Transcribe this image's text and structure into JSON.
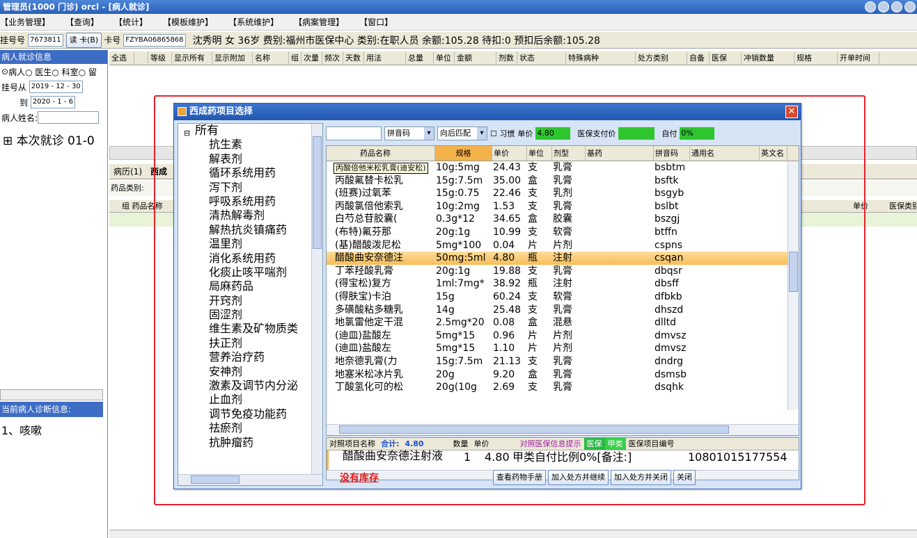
{
  "window": {
    "title": "管理员(1000 门诊)  orcl - [病人就诊]"
  },
  "menu": [
    "【业务管理】",
    "【查询】",
    "【统计】",
    "【模板维护】",
    "【系统维护】",
    "【病案管理】",
    "【窗口】"
  ],
  "patient": {
    "reg_label": "挂号号",
    "reg_no": "7673811",
    "read_card": "读 卡(B)",
    "card_label": "卡号",
    "card_no": "FZYBA06865868",
    "summary": "沈秀明 女 36岁 费别:福州市医保中心 类别:在职人员 余额:105.28 待扣:0 预扣后余额:105.28"
  },
  "left": {
    "header": "病人就诊信息",
    "radios": "病人○ 医生○ 科室○ 留",
    "from_label": "挂号从",
    "from_date": "2019 - 12 - 30",
    "to_label": "到",
    "to_date": "2020 - 1 - 6",
    "name_label": "病人姓名:",
    "tree_item": "本次就诊 01-0",
    "diag_header": "当前病人诊断信息:",
    "diag": "1、咳嗽"
  },
  "main_grid_headers": [
    "全选",
    "等级",
    "显示所有",
    "显示附加",
    "名称",
    "组",
    "次量",
    "频次",
    "天数",
    "用法",
    "总量",
    "单位",
    "金额",
    "剂数",
    "状态",
    "特殊病种",
    "处方类别",
    "自备",
    "医保",
    "冲销数量",
    "规格",
    "开单时间"
  ],
  "middle": {
    "tabs": [
      "病历(1)",
      "西成"
    ],
    "category_label": "药品类别:",
    "grid_head_group": "组",
    "grid_head_name": "药品名称",
    "grid_head_price": "单价",
    "grid_head_ins": "医保类别"
  },
  "dialog": {
    "title": "西成药项目选择",
    "tree": {
      "root": "所有",
      "items": [
        "抗生素",
        "解表剂",
        "循环系统用药",
        "泻下剂",
        "呼吸系统用药",
        "清热解毒剂",
        "解热抗炎镇痛药",
        "温里剂",
        "消化系统用药",
        "化痰止咳平喘剂",
        "局麻药品",
        "开窍剂",
        "固涩剂",
        "维生素及矿物质类",
        "扶正剂",
        "营养治疗药",
        "安神剂",
        "激素及调节内分泌",
        "止血剂",
        "调节免疫功能药",
        "祛瘀剂",
        "抗肿瘤药"
      ]
    },
    "filter": {
      "mode": "拼音码",
      "match": "向后匹配",
      "habit": "习惯",
      "price_label": "单价",
      "price_value": "4.80",
      "ins_label": "医保支付价",
      "selfpay_label": "自付",
      "selfpay_value": "0%"
    },
    "grid_headers": [
      "药品名称",
      "规格",
      "单价",
      "单位",
      "剂型",
      "基药",
      "拼音码",
      "通用名",
      "英文名"
    ],
    "tooltip": "丙酸倍他米松乳膏(迪安松)",
    "rows": [
      {
        "name": "",
        "spec": "10g:5mg",
        "price": "24.43",
        "unit": "支",
        "form": "乳膏",
        "code": "bsbtm"
      },
      {
        "name": "丙酸氟替卡松乳",
        "spec": "15g:7.5m",
        "price": "35.00",
        "unit": "盒",
        "form": "乳膏",
        "code": "bsftk"
      },
      {
        "name": "(班赛)过氧苯",
        "spec": "15g:0.75",
        "price": "22.46",
        "unit": "支",
        "form": "乳剂",
        "code": "bsgyb"
      },
      {
        "name": "丙酸氯倍他索乳",
        "spec": "10g:2mg",
        "price": "1.53",
        "unit": "支",
        "form": "乳膏",
        "code": "bslbt"
      },
      {
        "name": "白芍总苷胶囊(",
        "spec": "0.3g*12",
        "price": "34.65",
        "unit": "盒",
        "form": "胶囊",
        "code": "bszgj"
      },
      {
        "name": "(布特)氟芬那",
        "spec": "20g:1g",
        "price": "10.99",
        "unit": "支",
        "form": "软膏",
        "code": "btffn"
      },
      {
        "name": "(基)醋酸泼尼松",
        "spec": "5mg*100",
        "price": "0.04",
        "unit": "片",
        "form": "片剂",
        "code": "cspns"
      },
      {
        "name": "醋酸曲安奈德注",
        "spec": "50mg:5ml",
        "price": "4.80",
        "unit": "瓶",
        "form": "注射",
        "code": "csqan"
      },
      {
        "name": "丁苯羟酸乳膏",
        "spec": "20g:1g",
        "price": "19.88",
        "unit": "支",
        "form": "乳膏",
        "code": "dbqsr"
      },
      {
        "name": "(得宝松)复方",
        "spec": "1ml:7mg*",
        "price": "38.92",
        "unit": "瓶",
        "form": "注射",
        "code": "dbsff"
      },
      {
        "name": "(得肤宝)卡泊",
        "spec": "15g",
        "price": "60.24",
        "unit": "支",
        "form": "软膏",
        "code": "dfbkb"
      },
      {
        "name": "多磺酸粘多糖乳",
        "spec": "14g",
        "price": "25.48",
        "unit": "支",
        "form": "乳膏",
        "code": "dhszd"
      },
      {
        "name": "地氯雷他定干混",
        "spec": "2.5mg*20",
        "price": "0.08",
        "unit": "盒",
        "form": "混悬",
        "code": "dlltd"
      },
      {
        "name": "(迪皿)盐酸左",
        "spec": "5mg*15",
        "price": "0.96",
        "unit": "片",
        "form": "片剂",
        "code": "dmvsz"
      },
      {
        "name": "(迪皿)盐酸左",
        "spec": "5mg*15",
        "price": "1.10",
        "unit": "片",
        "form": "片剂",
        "code": "dmvsz"
      },
      {
        "name": "地奈德乳膏(力",
        "spec": "15g:7.5m",
        "price": "21.13",
        "unit": "支",
        "form": "乳膏",
        "code": "dndrg"
      },
      {
        "name": "地塞米松冰片乳",
        "spec": "20g",
        "price": "9.20",
        "unit": "盒",
        "form": "乳膏",
        "code": "dsmsb"
      },
      {
        "name": "丁酸氢化可的松",
        "spec": "20g(10g",
        "price": "2.69",
        "unit": "支",
        "form": "乳膏",
        "code": "dsqhk"
      }
    ],
    "selected": {
      "head_label": "对照项目名称",
      "total_label": "合计:",
      "total": "4.80",
      "qty_label": "数量",
      "price_label": "单价",
      "ins_hint": "对照医保信息提示",
      "ins_badge": "医保",
      "class_badge": "甲类",
      "code_label": "医保项目编号",
      "name": "醋酸曲安奈德注射液",
      "qty": "1",
      "price": "4.80",
      "ratio": "甲类自付比例0%[备注:]",
      "code": "10801015177554"
    },
    "no_stock": "没有库存",
    "buttons": [
      "查看药物手册",
      "加入处方并继续",
      "加入处方并关闭",
      "关闭"
    ]
  }
}
